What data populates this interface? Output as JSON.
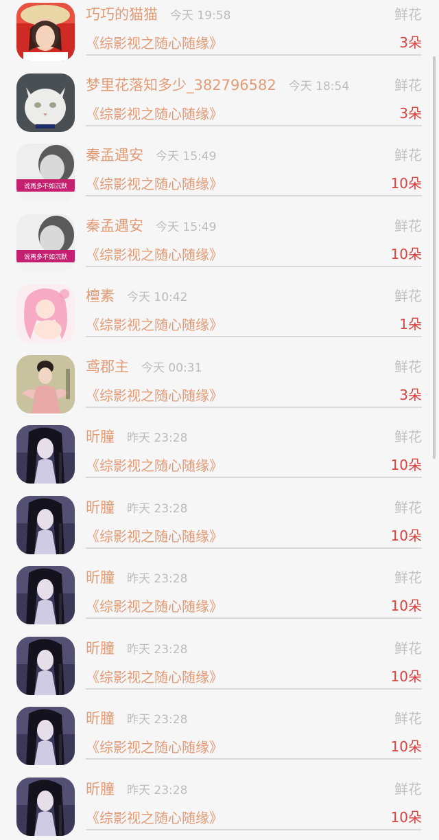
{
  "colors": {
    "background": "#f6f6f6",
    "name": "#e39b76",
    "time": "#bcbcbc",
    "gift_label": "#c0c0c0",
    "count": "#d8423f",
    "divider": "#d9d9d9"
  },
  "records": [
    {
      "name": "巧巧的猫猫",
      "time": "今天 19:58",
      "gift": "鲜花",
      "book": "《综影视之随心随缘》",
      "count": "3朵",
      "avatar": "avatar-woman-hat"
    },
    {
      "name": "梦里花落知多少_382796582",
      "time": "今天 18:54",
      "gift": "鲜花",
      "book": "《综影视之随心随缘》",
      "count": "3朵",
      "avatar": "avatar-white-cat"
    },
    {
      "name": "秦孟遇安",
      "time": "今天 15:49",
      "gift": "鲜花",
      "book": "《综影视之随心随缘》",
      "count": "10朵",
      "avatar": "avatar-girl-caption",
      "avatar_caption": "说再多不如沉默"
    },
    {
      "name": "秦孟遇安",
      "time": "今天 15:49",
      "gift": "鲜花",
      "book": "《综影视之随心随缘》",
      "count": "10朵",
      "avatar": "avatar-girl-caption",
      "avatar_caption": "说再多不如沉默"
    },
    {
      "name": "檀素",
      "time": "今天 10:42",
      "gift": "鲜花",
      "book": "《综影视之随心随缘》",
      "count": "1朵",
      "avatar": "avatar-anime-pink"
    },
    {
      "name": "鸢郡主",
      "time": "今天 00:31",
      "gift": "鲜花",
      "book": "《综影视之随心随缘》",
      "count": "3朵",
      "avatar": "avatar-ancient-lady"
    },
    {
      "name": "昕朣",
      "time": "昨天 23:28",
      "gift": "鲜花",
      "book": "《综影视之随心随缘》",
      "count": "10朵",
      "avatar": "avatar-dark-hair-girl"
    },
    {
      "name": "昕朣",
      "time": "昨天 23:28",
      "gift": "鲜花",
      "book": "《综影视之随心随缘》",
      "count": "10朵",
      "avatar": "avatar-dark-hair-girl"
    },
    {
      "name": "昕朣",
      "time": "昨天 23:28",
      "gift": "鲜花",
      "book": "《综影视之随心随缘》",
      "count": "10朵",
      "avatar": "avatar-dark-hair-girl"
    },
    {
      "name": "昕朣",
      "time": "昨天 23:28",
      "gift": "鲜花",
      "book": "《综影视之随心随缘》",
      "count": "10朵",
      "avatar": "avatar-dark-hair-girl"
    },
    {
      "name": "昕朣",
      "time": "昨天 23:28",
      "gift": "鲜花",
      "book": "《综影视之随心随缘》",
      "count": "10朵",
      "avatar": "avatar-dark-hair-girl"
    },
    {
      "name": "昕朣",
      "time": "昨天 23:28",
      "gift": "鲜花",
      "book": "《综影视之随心随缘》",
      "count": "10朵",
      "avatar": "avatar-dark-hair-girl"
    }
  ]
}
